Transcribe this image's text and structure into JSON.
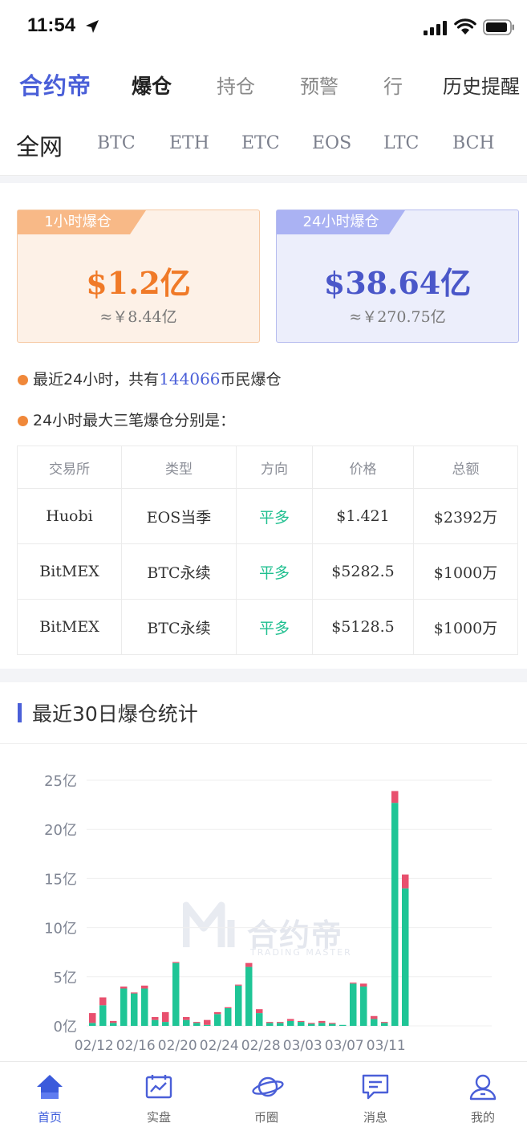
{
  "status_bar": {
    "time": "11:54"
  },
  "top_nav": {
    "brand": "合约帝",
    "tabs": [
      {
        "label": "爆仓",
        "active": true
      },
      {
        "label": "持仓",
        "active": false
      },
      {
        "label": "预警",
        "active": false
      },
      {
        "label": "行",
        "active": false
      },
      {
        "label": "历史提醒",
        "active": false
      }
    ]
  },
  "sub_nav": [
    "全网",
    "BTC",
    "ETH",
    "ETC",
    "EOS",
    "LTC",
    "BCH"
  ],
  "summary": {
    "one_hour": {
      "label": "1小时爆仓",
      "value": "$1.2亿",
      "cny": "≈￥8.44亿"
    },
    "day": {
      "label": "24小时爆仓",
      "value": "$38.64亿",
      "cny": "≈￥270.75亿"
    }
  },
  "info": {
    "line1_prefix": "最近24小时，共有",
    "line1_count": "144066",
    "line1_suffix": "币民爆仓",
    "line2": "24小时最大三笔爆仓分别是："
  },
  "table": {
    "headers": [
      "交易所",
      "类型",
      "方向",
      "价格",
      "总额"
    ],
    "rows": [
      [
        "Huobi",
        "EOS当季",
        "平多",
        "$1.421",
        "$2392万"
      ],
      [
        "BitMEX",
        "BTC永续",
        "平多",
        "$5282.5",
        "$1000万"
      ],
      [
        "BitMEX",
        "BTC永续",
        "平多",
        "$5128.5",
        "$1000万"
      ]
    ]
  },
  "chart_section": {
    "title": "最近30日爆仓统计",
    "watermark": "合约帝",
    "watermark_sub": "TRADING MASTER"
  },
  "chart_data": {
    "type": "bar",
    "stacked": true,
    "y_ticks": [
      "0亿",
      "5亿",
      "10亿",
      "15亿",
      "20亿",
      "25亿"
    ],
    "ylim": [
      0,
      25
    ],
    "x_ticks": [
      "02/12",
      "02/16",
      "02/20",
      "02/24",
      "02/28",
      "03/03",
      "03/07",
      "03/11"
    ],
    "colors": {
      "long": "#1fc596",
      "short": "#e8506e",
      "grid": "#efefef"
    },
    "categories": [
      "02/12",
      "02/13",
      "02/14",
      "02/15",
      "02/16",
      "02/17",
      "02/18",
      "02/19",
      "02/20",
      "02/21",
      "02/22",
      "02/23",
      "02/24",
      "02/25",
      "02/26",
      "02/27",
      "02/28",
      "03/01",
      "03/02",
      "03/03",
      "03/04",
      "03/05",
      "03/06",
      "03/07",
      "03/08",
      "03/09",
      "03/10",
      "03/11",
      "03/12",
      "03/13"
    ],
    "series": [
      {
        "key": "long",
        "values": [
          0.3,
          2.1,
          0.3,
          3.8,
          3.3,
          3.8,
          0.6,
          0.4,
          6.4,
          0.6,
          0.3,
          0.1,
          1.2,
          1.8,
          4.1,
          6.0,
          1.3,
          0.3,
          0.3,
          0.5,
          0.4,
          0.2,
          0.3,
          0.2,
          0.1,
          4.3,
          4.0,
          0.7,
          0.3,
          22.7,
          14.0
        ]
      },
      {
        "key": "short",
        "values": [
          1.0,
          0.8,
          0.2,
          0.2,
          0.1,
          0.3,
          0.3,
          1.0,
          0.1,
          0.3,
          0.1,
          0.5,
          0.2,
          0.1,
          0.1,
          0.4,
          0.4,
          0.1,
          0.1,
          0.2,
          0.1,
          0.1,
          0.2,
          0.1,
          0.0,
          0.1,
          0.3,
          0.3,
          0.1,
          1.2,
          1.4
        ]
      }
    ]
  },
  "tab_bar": [
    {
      "label": "首页",
      "icon": "home-icon",
      "active": true
    },
    {
      "label": "实盘",
      "icon": "chart-board-icon",
      "active": false
    },
    {
      "label": "币圈",
      "icon": "planet-icon",
      "active": false
    },
    {
      "label": "消息",
      "icon": "message-icon",
      "active": false
    },
    {
      "label": "我的",
      "icon": "user-icon",
      "active": false
    }
  ]
}
